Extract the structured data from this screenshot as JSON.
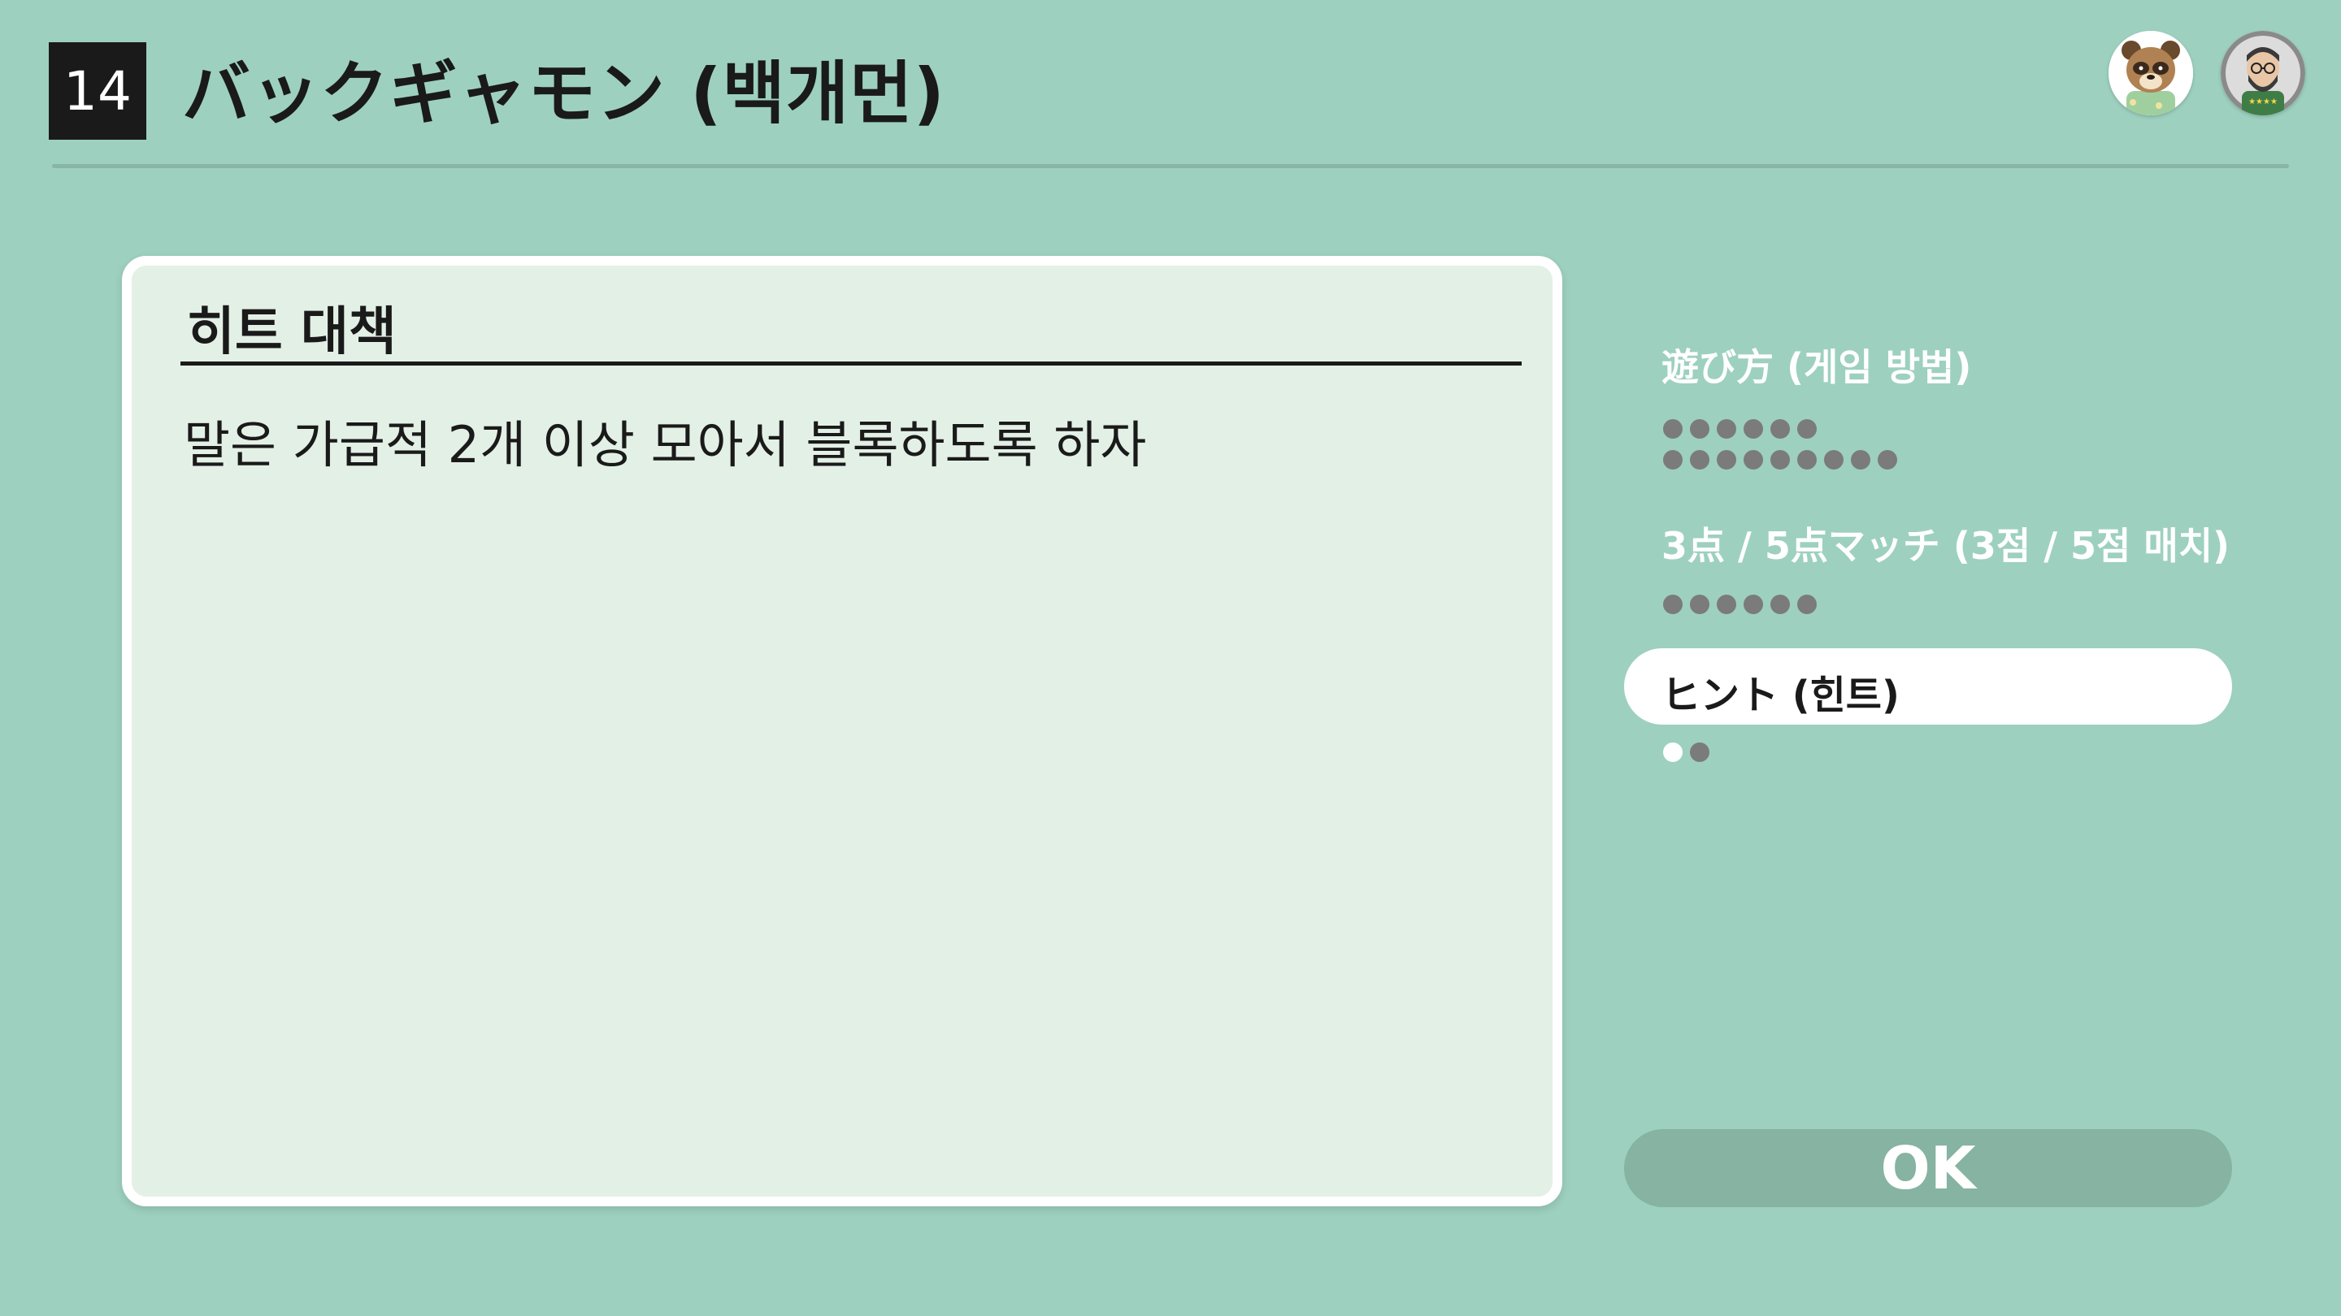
{
  "header": {
    "number": "14",
    "title": "バックギャモン (백개먼)"
  },
  "panel": {
    "title": "히트 대책",
    "body": "말은 가급적 2개 이상 모아서 블록하도록 하자"
  },
  "menu": {
    "items": [
      {
        "label": "遊び方 (게임 방법)",
        "pages_total": 15,
        "pages_read": 0
      },
      {
        "label": "3点 / 5点マッチ (3점 / 5점 매치)",
        "pages_total": 6,
        "pages_read": 0
      },
      {
        "label": "ヒント (힌트)",
        "pages_total": 2,
        "pages_read": 1,
        "selected": true
      }
    ]
  },
  "ok_label": "OK",
  "colors": {
    "background": "#9dd0bf",
    "panel": "#e3f0e6",
    "ok_button": "#86b3a2",
    "dot_unread": "#7b7b7b",
    "dot_read": "#ffffff"
  },
  "icons": {
    "avatar_1": "raccoon-shopkeeper-avatar-icon",
    "avatar_2": "bearded-man-with-glasses-avatar-icon"
  }
}
